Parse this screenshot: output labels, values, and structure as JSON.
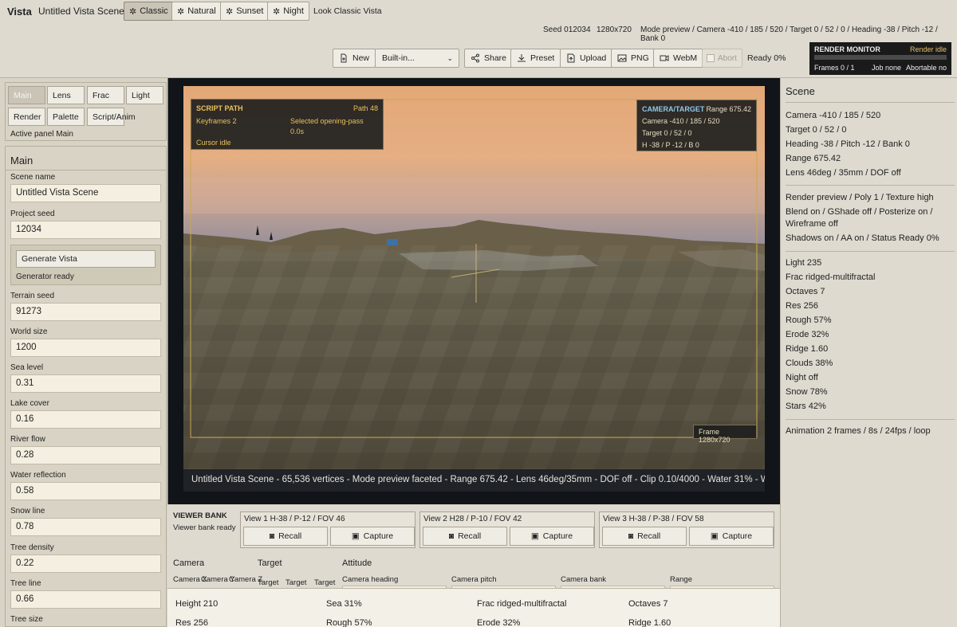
{
  "app": {
    "name": "Vista",
    "scene_title": "Untitled Vista Scene"
  },
  "looks": [
    {
      "label": "Classic",
      "active": true
    },
    {
      "label": "Natural",
      "active": false
    },
    {
      "label": "Sunset",
      "active": false
    },
    {
      "label": "Night",
      "active": false
    }
  ],
  "look_status": "Look Classic Vista",
  "status": {
    "seed": "Seed 012034",
    "resolution": "1280x720",
    "mode": "Mode preview / Camera -410 / 185 / 520 / Target 0 / 52 / 0 / Heading -38 / Pitch -12 / Bank 0"
  },
  "toolbar": {
    "new": "New",
    "preset_select": "Built-in...",
    "share": "Share",
    "preset": "Preset",
    "upload": "Upload",
    "png": "PNG",
    "webm": "WebM",
    "abort": "Abort",
    "ready": "Ready 0%"
  },
  "render_monitor": {
    "title": "RENDER MONITOR",
    "state": "Render idle",
    "progress": 0,
    "frames": "Frames 0 / 1",
    "job": "Job none",
    "abortable": "Abortable no"
  },
  "panel_tabs": [
    "Main",
    "Lens",
    "Frac",
    "Light",
    "Render",
    "Palette",
    "Script/Anim"
  ],
  "active_panel": "Active panel Main",
  "main_panel": {
    "title": "Main",
    "scene_name_label": "Scene name",
    "scene_name": "Untitled Vista Scene",
    "project_seed_label": "Project seed",
    "project_seed": "12034",
    "generate_button": "Generate Vista",
    "generator_status": "Generator ready",
    "fields": [
      {
        "label": "Terrain seed",
        "value": "91273"
      },
      {
        "label": "World size",
        "value": "1200"
      },
      {
        "label": "Sea level",
        "value": "0.31"
      },
      {
        "label": "Lake cover",
        "value": "0.16"
      },
      {
        "label": "River flow",
        "value": "0.28"
      },
      {
        "label": "Water reflection",
        "value": "0.58"
      },
      {
        "label": "Snow line",
        "value": "0.78"
      },
      {
        "label": "Tree density",
        "value": "0.22"
      },
      {
        "label": "Tree line",
        "value": "0.66"
      },
      {
        "label": "Tree size",
        "value": ""
      }
    ]
  },
  "hud": {
    "script_title": "SCRIPT PATH",
    "path": "Path 48",
    "keyframes": "Keyframes 2",
    "selected": "Selected opening-pass",
    "selected_time": "0.0s",
    "cursor": "Cursor idle",
    "camera_title": "CAMERA/TARGET",
    "range": "Range 675.42",
    "camera": "Camera -410 / 185 / 520",
    "target": "Target 0 / 52 / 0",
    "hpb": "H -38 / P -12 / B 0",
    "frame": "Frame 1280x720",
    "caption": "Untitled Vista Scene - 65,536 vertices - Mode preview faceted - Range 675.42 - Lens 46deg/35mm - DOF off - Clip 0.10/4000 - Water 31% - W..."
  },
  "right_panel": {
    "title": "Scene",
    "group1": [
      "Camera -410 / 185 / 520",
      "Target 0 / 52 / 0",
      "Heading -38 / Pitch -12 / Bank 0",
      "Range 675.42",
      "Lens 46deg / 35mm / DOF off"
    ],
    "group2": [
      "Render preview / Poly 1 / Texture high",
      "Blend on / GShade off / Posterize on /",
      "Wireframe off",
      "Shadows on / AA on / Status Ready 0%"
    ],
    "group3": [
      "Light 235",
      "Frac ridged-multifractal",
      "Octaves 7",
      "Res 256",
      "Rough 57%",
      "Erode 32%",
      "Ridge 1.60",
      "Clouds 38%",
      "Night off",
      "Snow 78%",
      "Stars 42%"
    ],
    "group4": [
      "Animation 2 frames / 8s / 24fps / loop"
    ]
  },
  "viewer_bank": {
    "title": "VIEWER BANK",
    "status": "Viewer bank ready",
    "views": [
      "View 1 H-38 / P-12 / FOV 46",
      "View 2 H28 / P-10 / FOV 42",
      "View 3 H-38 / P-38 / FOV 58"
    ],
    "recall": "Recall",
    "capture": "Capture"
  },
  "controls": {
    "camera": "Camera",
    "target": "Target",
    "attitude": "Attitude",
    "cam_x": "Camera X",
    "cam_y": "Camera Y",
    "cam_z": "Camera Z",
    "target_1": "Target",
    "target_2": "Target",
    "target_3": "Target",
    "heading": "Camera heading",
    "pitch": "Camera pitch",
    "bank": "Camera bank",
    "range": "Range"
  },
  "bottom_stats": [
    "Height 210",
    "Sea 31%",
    "Frac ridged-multifractal",
    "Octaves 7",
    "Res 256",
    "Rough 57%",
    "Erode 32%",
    "Ridge 1.60"
  ]
}
